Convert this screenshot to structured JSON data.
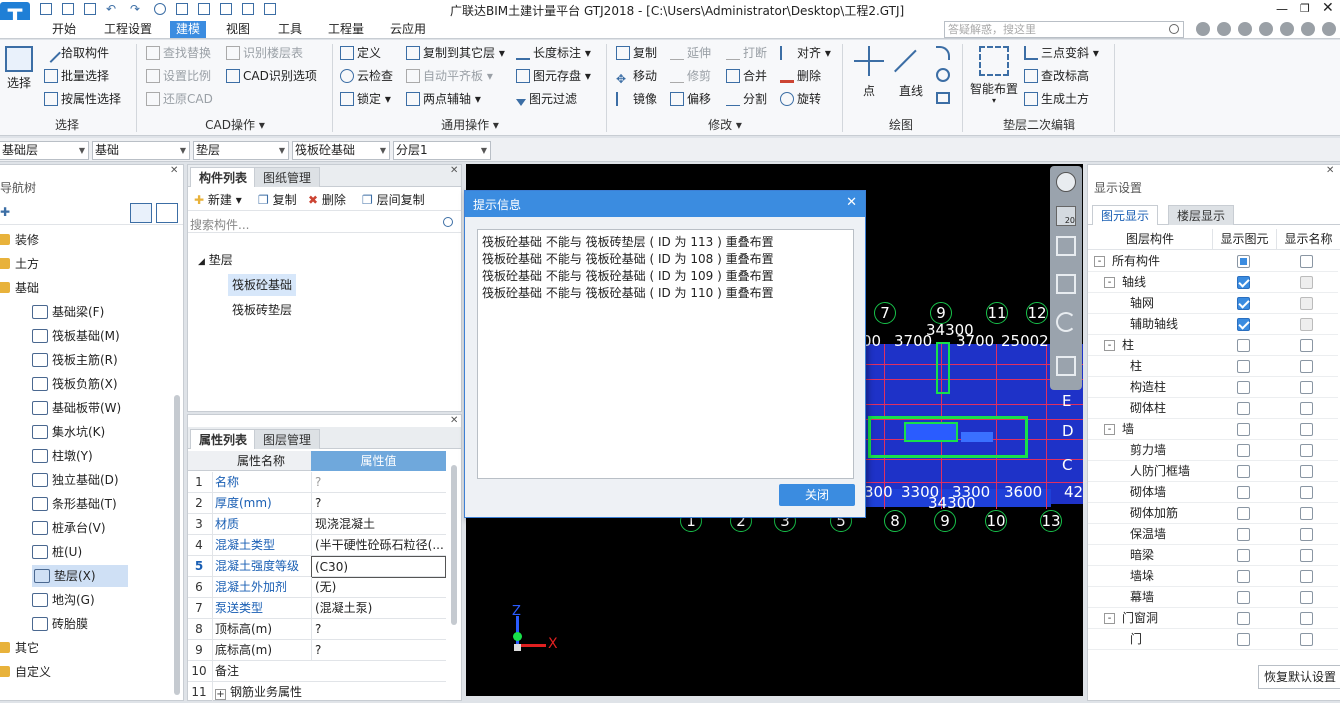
{
  "app": {
    "title": "广联达BIM土建计量平台 GTJ2018 - [C:\\Users\\Administrator\\Desktop\\工程2.GTJ]",
    "logo_letter": "T",
    "search_placeholder": "答疑解惑，搜这里",
    "accent": "#3b8ce0"
  },
  "menu": [
    "开始",
    "工程设置",
    "建模",
    "视图",
    "工具",
    "工程量",
    "云应用"
  ],
  "ribbon": {
    "select": {
      "label": "选择",
      "group": "选择",
      "items": [
        "拾取构件",
        "批量选择",
        "按属性选择"
      ]
    },
    "cad": {
      "group": "CAD操作",
      "items": [
        "查找替换",
        "识别楼层表",
        "设置比例",
        "CAD识别选项",
        "还原CAD"
      ]
    },
    "general": {
      "group": "通用操作",
      "items": [
        "定义",
        "复制到其它层",
        "长度标注",
        "云检查",
        "自动平齐板",
        "图元存盘",
        "锁定",
        "两点辅轴",
        "图元过滤"
      ]
    },
    "modify": {
      "group": "修改",
      "items": [
        "复制",
        "延伸",
        "打断",
        "对齐",
        "移动",
        "修剪",
        "合并",
        "删除",
        "镜像",
        "偏移",
        "分割",
        "旋转"
      ]
    },
    "draw": {
      "group": "绘图",
      "items": [
        "点",
        "直线"
      ]
    },
    "cushion": {
      "group": "垫层二次编辑",
      "items": [
        "智能布置",
        "三点变斜",
        "查改标高",
        "生成土方"
      ]
    }
  },
  "selectors": [
    "基础层",
    "基础",
    "垫层",
    "筏板砼基础",
    "分层1"
  ],
  "nav": {
    "title": "导航树",
    "items": [
      {
        "label": "装修",
        "kind": "folder"
      },
      {
        "label": "土方",
        "kind": "folder"
      },
      {
        "label": "基础",
        "kind": "folder"
      },
      {
        "label": "基础梁(F)",
        "kind": "item"
      },
      {
        "label": "筏板基础(M)",
        "kind": "item"
      },
      {
        "label": "筏板主筋(R)",
        "kind": "item"
      },
      {
        "label": "筏板负筋(X)",
        "kind": "item"
      },
      {
        "label": "基础板带(W)",
        "kind": "item"
      },
      {
        "label": "集水坑(K)",
        "kind": "item"
      },
      {
        "label": "柱墩(Y)",
        "kind": "item"
      },
      {
        "label": "独立基础(D)",
        "kind": "item"
      },
      {
        "label": "条形基础(T)",
        "kind": "item"
      },
      {
        "label": "桩承台(V)",
        "kind": "item"
      },
      {
        "label": "桩(U)",
        "kind": "item"
      },
      {
        "label": "垫层(X)",
        "kind": "item",
        "selected": true
      },
      {
        "label": "地沟(G)",
        "kind": "item"
      },
      {
        "label": "砖胎膜",
        "kind": "item"
      },
      {
        "label": "其它",
        "kind": "folder"
      },
      {
        "label": "自定义",
        "kind": "folder"
      }
    ]
  },
  "component_list": {
    "tabs": [
      "构件列表",
      "图纸管理"
    ],
    "toolbar": [
      "新建",
      "复制",
      "删除",
      "层间复制"
    ],
    "search_placeholder": "搜索构件...",
    "root": "垫层",
    "items": [
      "筏板砼基础",
      "筏板砖垫层"
    ],
    "selected": "筏板砼基础"
  },
  "properties": {
    "tabs": [
      "属性列表",
      "图层管理"
    ],
    "col_name": "属性名称",
    "col_value": "属性值",
    "rows": [
      {
        "n": "1",
        "k": "名称",
        "v": "?"
      },
      {
        "n": "2",
        "k": "厚度(mm)",
        "v": "?"
      },
      {
        "n": "3",
        "k": "材质",
        "v": "现浇混凝土"
      },
      {
        "n": "4",
        "k": "混凝土类型",
        "v": "(半干硬性砼砾石粒径(..."
      },
      {
        "n": "5",
        "k": "混凝土强度等级",
        "v": "(C30)"
      },
      {
        "n": "6",
        "k": "混凝土外加剂",
        "v": "(无)"
      },
      {
        "n": "7",
        "k": "泵送类型",
        "v": "(混凝土泵)"
      },
      {
        "n": "8",
        "k": "顶标高(m)",
        "v": "?"
      },
      {
        "n": "9",
        "k": "底标高(m)",
        "v": "?"
      },
      {
        "n": "10",
        "k": "备注",
        "v": ""
      },
      {
        "n": "11",
        "k": "钢筋业务属性",
        "v": ""
      }
    ]
  },
  "dialog": {
    "title": "提示信息",
    "lines": [
      "筏板砼基础 不能与 筏板砖垫层 ( ID 为 113 ) 重叠布置",
      "筏板砼基础 不能与 筏板砼基础 ( ID 为 108 ) 重叠布置",
      "筏板砼基础 不能与 筏板砼基础 ( ID 为 109 ) 重叠布置",
      "筏板砼基础 不能与 筏板砼基础 ( ID 为 110 ) 重叠布置"
    ],
    "close_label": "关闭"
  },
  "cad": {
    "top_axes": [
      "7",
      "9",
      "11",
      "12"
    ],
    "bottom_axes": [
      "1",
      "2",
      "3",
      "5",
      "8",
      "9",
      "10",
      "13"
    ],
    "top_dims": [
      "00",
      "3700",
      "3700",
      "25002",
      "34300"
    ],
    "bottom_dims": [
      "300",
      "3300",
      "3300",
      "3600",
      "42",
      "34300"
    ],
    "right_labels": [
      "E",
      "D",
      "C"
    ],
    "zoom_badge": "20",
    "axis_x": "X",
    "axis_z": "Z"
  },
  "display": {
    "title": "显示设置",
    "tabs": [
      "图元显示",
      "楼层显示"
    ],
    "col_component": "图层构件",
    "col_show": "显示图元",
    "col_name": "显示名称",
    "rows": [
      {
        "label": "所有构件",
        "level": 0,
        "expander": "-",
        "show": "mixed",
        "name": "off"
      },
      {
        "label": "轴线",
        "level": 1,
        "expander": "-",
        "show": "on",
        "name": "dis"
      },
      {
        "label": "轴网",
        "level": 2,
        "show": "on",
        "name": "dis"
      },
      {
        "label": "辅助轴线",
        "level": 2,
        "show": "on",
        "name": "dis"
      },
      {
        "label": "柱",
        "level": 1,
        "expander": "-",
        "show": "off",
        "name": "off"
      },
      {
        "label": "柱",
        "level": 2,
        "show": "off",
        "name": "off"
      },
      {
        "label": "构造柱",
        "level": 2,
        "show": "off",
        "name": "off"
      },
      {
        "label": "砌体柱",
        "level": 2,
        "show": "off",
        "name": "off"
      },
      {
        "label": "墙",
        "level": 1,
        "expander": "-",
        "show": "off",
        "name": "off"
      },
      {
        "label": "剪力墙",
        "level": 2,
        "show": "off",
        "name": "off"
      },
      {
        "label": "人防门框墙",
        "level": 2,
        "show": "off",
        "name": "off"
      },
      {
        "label": "砌体墙",
        "level": 2,
        "show": "off",
        "name": "off"
      },
      {
        "label": "砌体加筋",
        "level": 2,
        "show": "off",
        "name": "off"
      },
      {
        "label": "保温墙",
        "level": 2,
        "show": "off",
        "name": "off"
      },
      {
        "label": "暗梁",
        "level": 2,
        "show": "off",
        "name": "off"
      },
      {
        "label": "墙垛",
        "level": 2,
        "show": "off",
        "name": "off"
      },
      {
        "label": "幕墙",
        "level": 2,
        "show": "off",
        "name": "off"
      },
      {
        "label": "门窗洞",
        "level": 1,
        "expander": "-",
        "show": "off",
        "name": "off"
      },
      {
        "label": "门",
        "level": 2,
        "show": "off",
        "name": "off"
      }
    ],
    "reset_label": "恢复默认设置"
  }
}
